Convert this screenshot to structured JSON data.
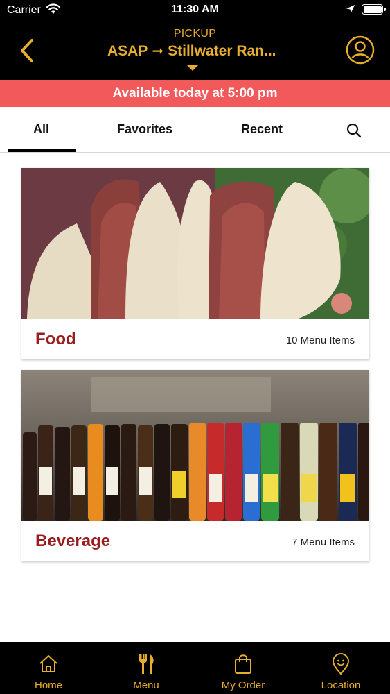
{
  "status_bar": {
    "carrier": "Carrier",
    "time": "11:30 AM"
  },
  "header": {
    "pickup_label": "PICKUP",
    "time_choice": "ASAP",
    "location": "Stillwater Ran...",
    "icons": {
      "back": "chevron-left-icon",
      "profile": "user-circle-icon",
      "dropdown": "caret-down-icon"
    },
    "accent_color": "#e7ad2f"
  },
  "banner": {
    "text": "Available today at 5:00 pm",
    "color": "#f2595b"
  },
  "tabs": [
    {
      "label": "All",
      "active": true
    },
    {
      "label": "Favorites",
      "active": false
    },
    {
      "label": "Recent",
      "active": false
    }
  ],
  "categories": [
    {
      "title": "Food",
      "count": "10 Menu Items"
    },
    {
      "title": "Beverage",
      "count": "7 Menu Items"
    }
  ],
  "bottom_nav": [
    {
      "label": "Home",
      "icon": "home-icon"
    },
    {
      "label": "Menu",
      "icon": "fork-knife-icon",
      "active": true
    },
    {
      "label": "My Order",
      "icon": "shopping-bag-icon"
    },
    {
      "label": "Location",
      "icon": "location-pin-icon"
    }
  ]
}
